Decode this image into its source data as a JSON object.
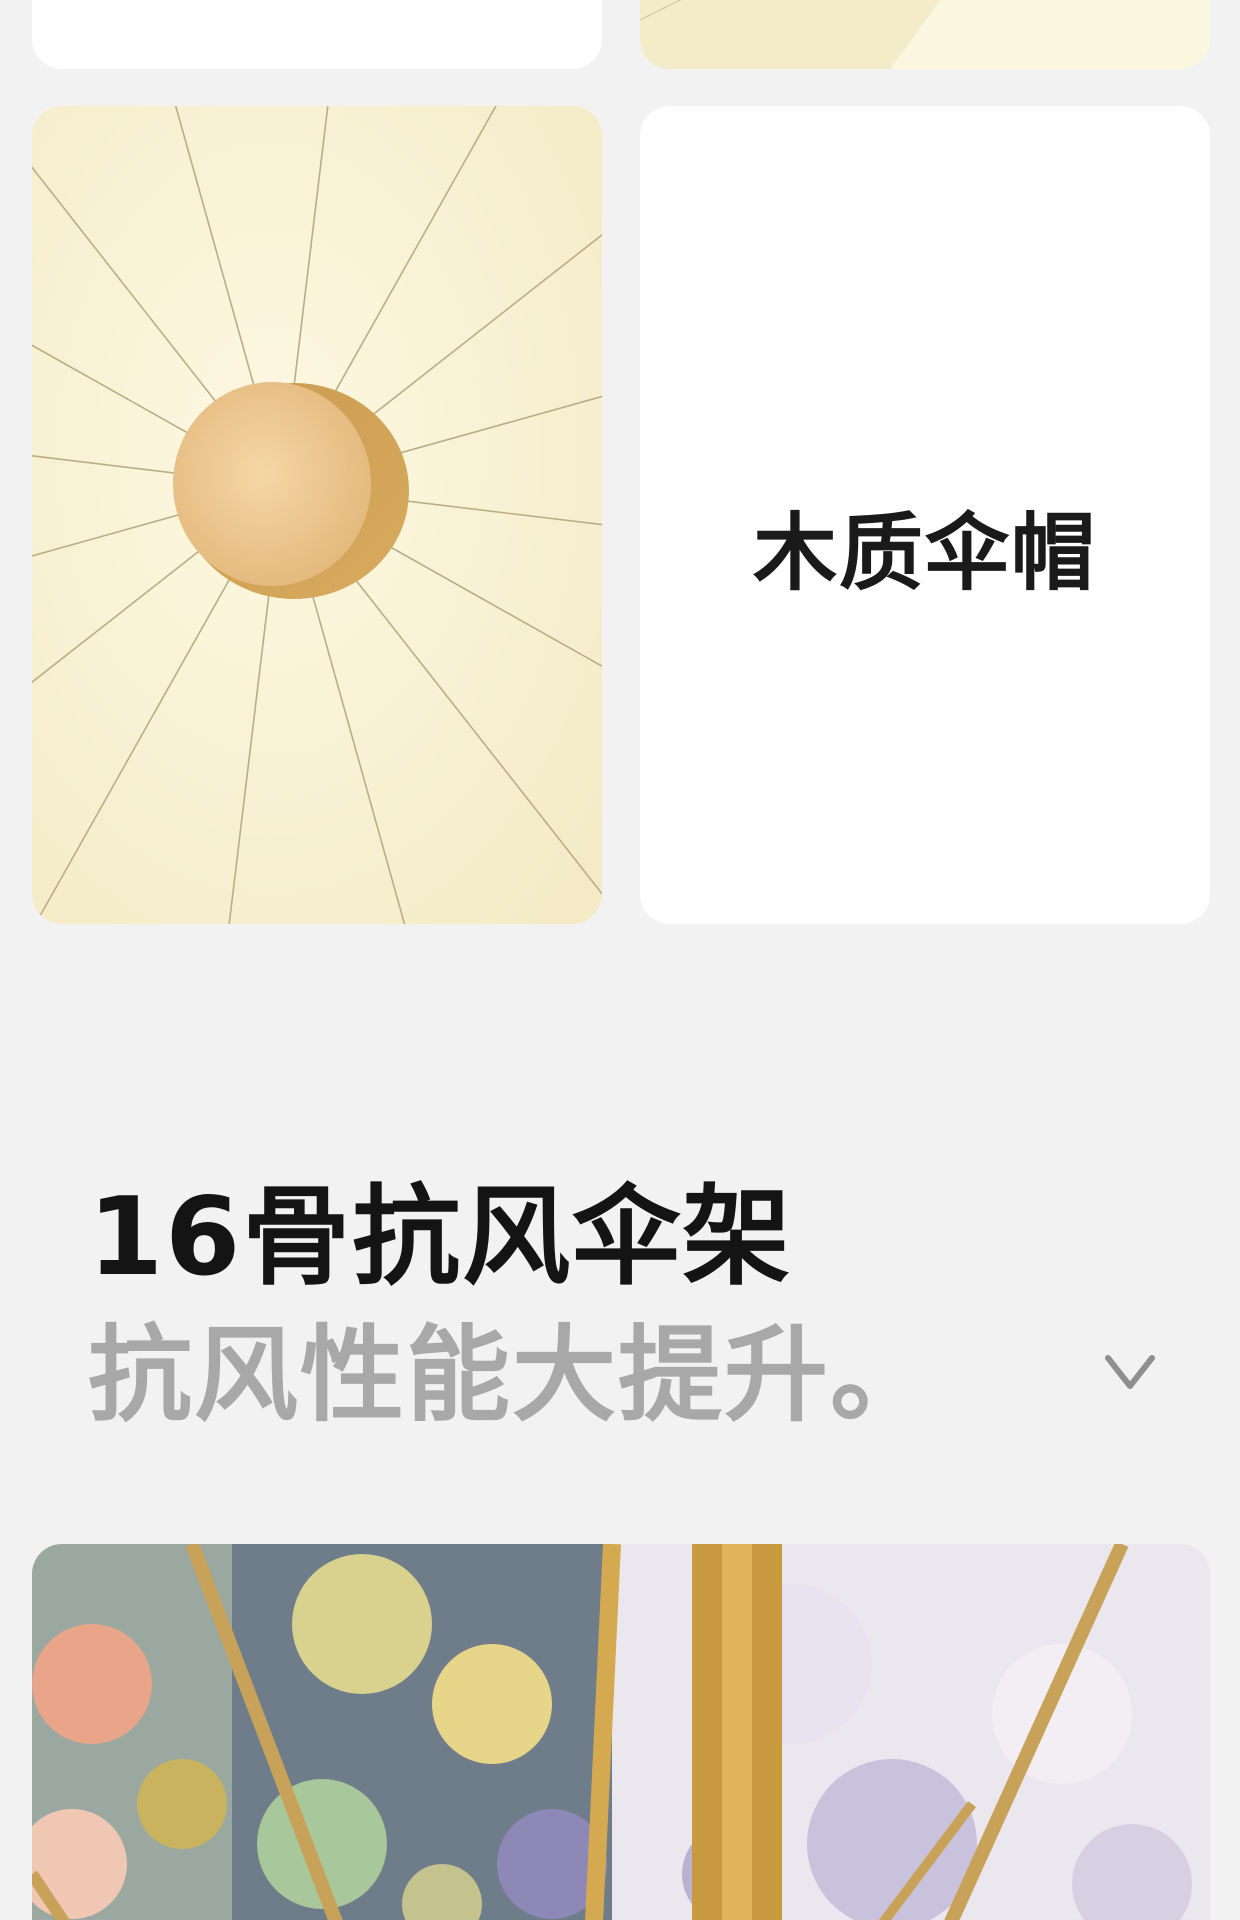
{
  "feature_card": {
    "label": "木质伞帽"
  },
  "section": {
    "title": "16骨抗风伞架",
    "subtitle": "抗风性能大提升。",
    "expand_icon": "chevron-down-icon"
  },
  "colors": {
    "background": "#f2f2f2",
    "card": "#ffffff",
    "canopy": "#fbf5dc",
    "wood": "#e6bd84",
    "title": "#141414",
    "subtitle": "#a8a8a8"
  }
}
